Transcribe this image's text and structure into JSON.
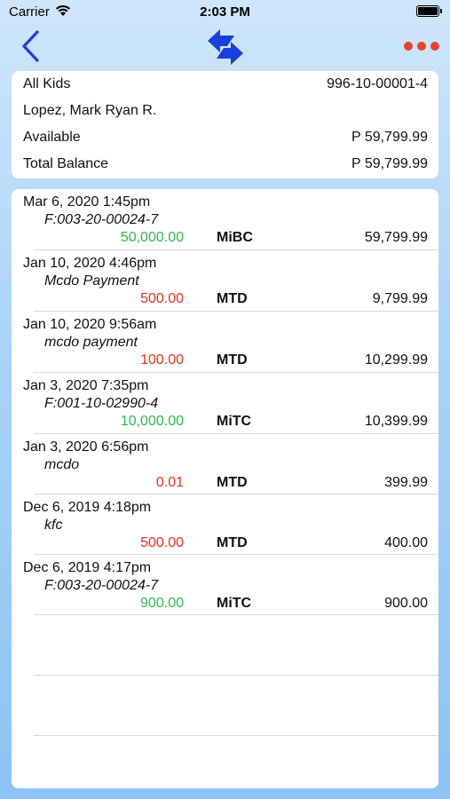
{
  "status_bar": {
    "carrier": "Carrier",
    "time": "2:03 PM"
  },
  "nav": {
    "back_icon": "chevron-left-icon",
    "sync_icon": "sync-arrows-icon",
    "more_icon": "more-dots-icon",
    "accent_color": "#1a3fe0",
    "more_color": "#e8412b"
  },
  "summary": {
    "account_name": "All Kids",
    "account_number": "996-10-00001-4",
    "holder_name": "Lopez, Mark Ryan R.",
    "available_label": "Available",
    "available_value": "P 59,799.99",
    "total_label": "Total Balance",
    "total_value": "P 59,799.99"
  },
  "transactions": [
    {
      "date": "Mar 6, 2020 1:45pm",
      "desc": "F:003-20-00024-7",
      "amount": "50,000.00",
      "kind": "credit",
      "type": "MiBC",
      "balance": "59,799.99"
    },
    {
      "date": "Jan 10, 2020 4:46pm",
      "desc": "Mcdo Payment",
      "amount": "500.00",
      "kind": "debit",
      "type": "MTD",
      "balance": "9,799.99"
    },
    {
      "date": "Jan 10, 2020 9:56am",
      "desc": "mcdo payment",
      "amount": "100.00",
      "kind": "debit",
      "type": "MTD",
      "balance": "10,299.99"
    },
    {
      "date": "Jan 3, 2020 7:35pm",
      "desc": "F:001-10-02990-4",
      "amount": "10,000.00",
      "kind": "credit",
      "type": "MiTC",
      "balance": "10,399.99"
    },
    {
      "date": "Jan 3, 2020 6:56pm",
      "desc": "mcdo",
      "amount": "0.01",
      "kind": "debit",
      "type": "MTD",
      "balance": "399.99"
    },
    {
      "date": "Dec 6, 2019 4:18pm",
      "desc": "kfc",
      "amount": "500.00",
      "kind": "debit",
      "type": "MTD",
      "balance": "400.00"
    },
    {
      "date": "Dec 6, 2019 4:17pm",
      "desc": "F:003-20-00024-7",
      "amount": "900.00",
      "kind": "credit",
      "type": "MiTC",
      "balance": "900.00"
    }
  ]
}
